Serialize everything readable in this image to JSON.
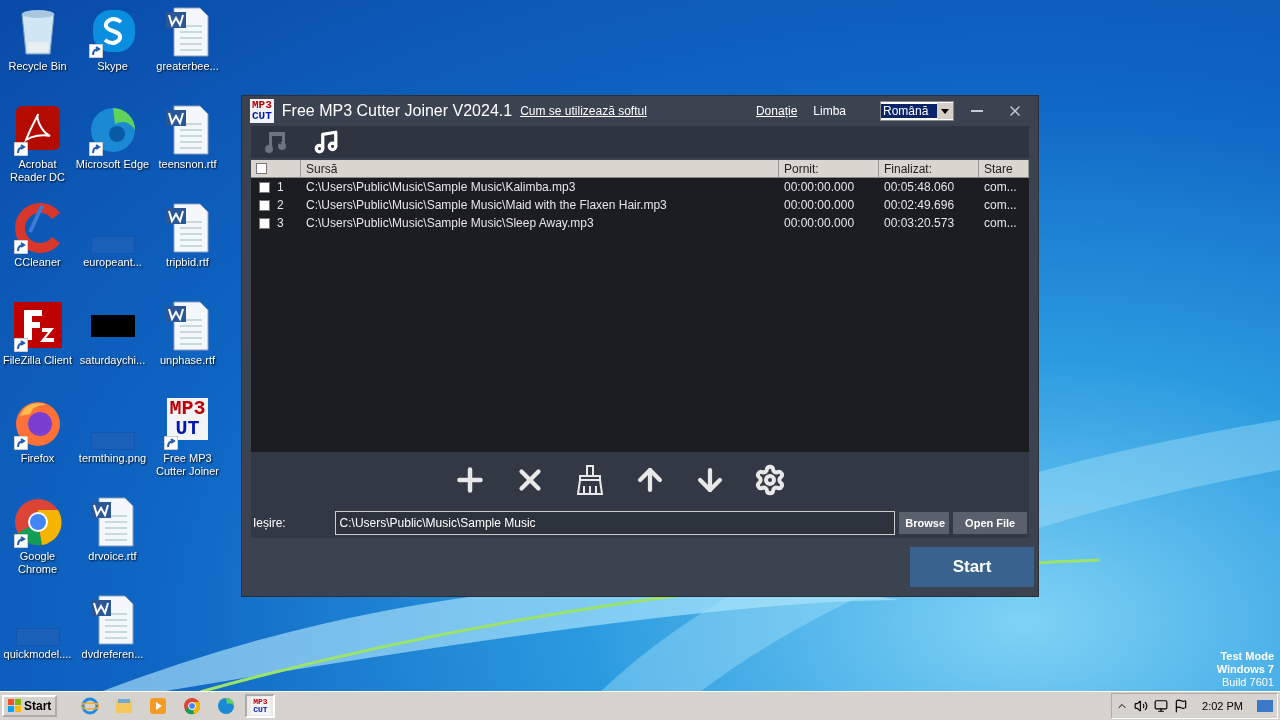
{
  "desktop_icons": [
    {
      "label": "Recycle Bin",
      "kind": "recycle",
      "shortcut": false
    },
    {
      "label": "Acrobat Reader DC",
      "kind": "acrobat",
      "shortcut": true
    },
    {
      "label": "CCleaner",
      "kind": "ccleaner",
      "shortcut": true
    },
    {
      "label": "FileZilla Client",
      "kind": "filezilla",
      "shortcut": true
    },
    {
      "label": "Firefox",
      "kind": "firefox",
      "shortcut": true
    },
    {
      "label": "Google Chrome",
      "kind": "chrome",
      "shortcut": true
    },
    {
      "label": "quickmodel....",
      "kind": "blank",
      "shortcut": false
    },
    {
      "label": "Skype",
      "kind": "skype",
      "shortcut": true
    },
    {
      "label": "Microsoft Edge",
      "kind": "edge",
      "shortcut": true
    },
    {
      "label": "europeant...",
      "kind": "blank",
      "shortcut": false
    },
    {
      "label": "saturdaychi...",
      "kind": "black",
      "shortcut": false
    },
    {
      "label": "termthing.png",
      "kind": "blank",
      "shortcut": false
    },
    {
      "label": "drvoice.rtf",
      "kind": "word",
      "shortcut": false
    },
    {
      "label": "dvdreferen...",
      "kind": "word",
      "shortcut": false
    },
    {
      "label": "greaterbee...",
      "kind": "word",
      "shortcut": false
    },
    {
      "label": "teensnon.rtf",
      "kind": "word",
      "shortcut": false
    },
    {
      "label": "tripbid.rtf",
      "kind": "word",
      "shortcut": false
    },
    {
      "label": "unphase.rtf",
      "kind": "word",
      "shortcut": false
    },
    {
      "label": "Free MP3 Cutter Joiner",
      "kind": "mp3",
      "shortcut": true,
      "logo_top": "MP3",
      "logo_bottom": "UT"
    }
  ],
  "window": {
    "logo_top": "MP3",
    "logo_bottom": "CUT",
    "title": "Free MP3 Cutter Joiner V2024.1",
    "help_link": "Cum se utilizează softul",
    "donate_link": "Donație",
    "language_label": "Limba",
    "language_value": "Română",
    "mode_tabs": [
      {
        "kind": "disabled-note",
        "selected": false
      },
      {
        "kind": "note",
        "selected": true
      }
    ],
    "table": {
      "header_checked": false,
      "columns": [
        "Sursă",
        "Pornit:",
        "Finalizat:",
        "Stare"
      ],
      "rows": [
        {
          "checked": false,
          "index": "1",
          "source": "C:\\Users\\Public\\Music\\Sample Music\\Kalimba.mp3",
          "start": "00:00:00.000",
          "end": "00:05:48.060",
          "status": "com..."
        },
        {
          "checked": false,
          "index": "2",
          "source": "C:\\Users\\Public\\Music\\Sample Music\\Maid with the Flaxen Hair.mp3",
          "start": "00:00:00.000",
          "end": "00:02:49.696",
          "status": "com..."
        },
        {
          "checked": false,
          "index": "3",
          "source": "C:\\Users\\Public\\Music\\Sample Music\\Sleep Away.mp3",
          "start": "00:00:00.000",
          "end": "00:03:20.573",
          "status": "com..."
        }
      ]
    },
    "tools": [
      {
        "kind": "add"
      },
      {
        "kind": "remove"
      },
      {
        "kind": "clear"
      },
      {
        "kind": "up"
      },
      {
        "kind": "down"
      },
      {
        "kind": "settings"
      }
    ],
    "output_label": "Ieșire:",
    "output_value": "C:\\Users\\Public\\Music\\Sample Music",
    "browse": "Browse",
    "open_file": "Open File",
    "start": "Start"
  },
  "watermark_os": [
    "Test Mode",
    "Windows 7",
    "Build 7601"
  ],
  "taskbar": {
    "start": "Start",
    "apps": [
      {
        "kind": "ie",
        "selected": false
      },
      {
        "kind": "explorer",
        "selected": false
      },
      {
        "kind": "media",
        "selected": false
      },
      {
        "kind": "chrome",
        "selected": false
      },
      {
        "kind": "edge",
        "selected": false
      },
      {
        "kind": "mp3",
        "selected": true,
        "logo_top": "MP3",
        "logo_bottom": "CUT"
      }
    ],
    "clock": "2:02 PM"
  }
}
